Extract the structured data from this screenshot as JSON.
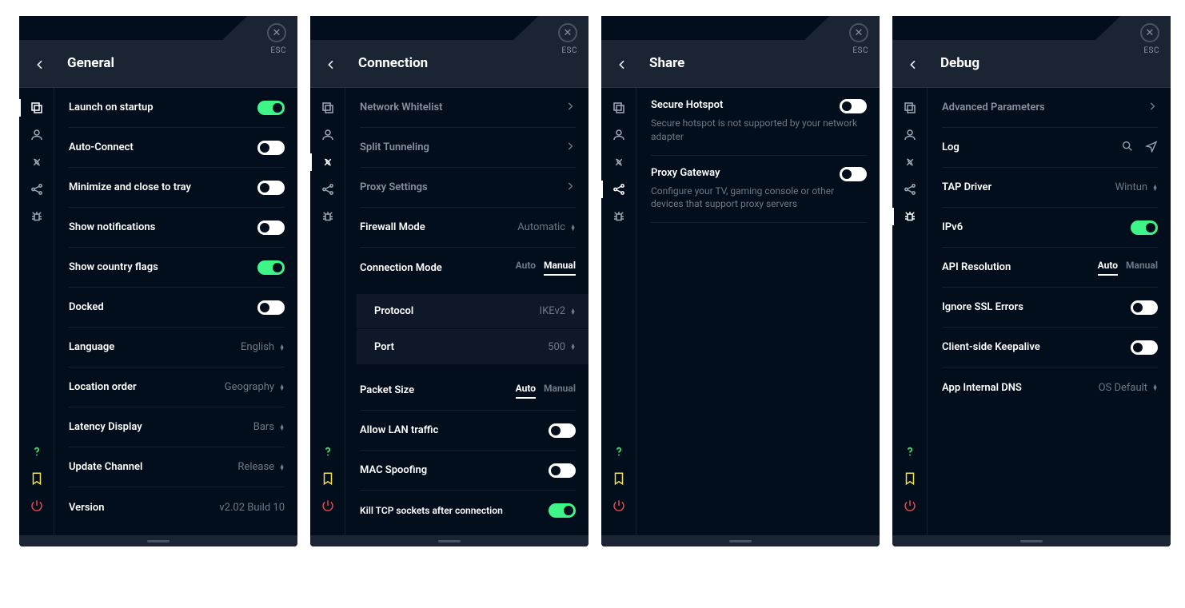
{
  "common": {
    "esc_label": "ESC"
  },
  "panels": {
    "general": {
      "title": "General",
      "items": {
        "launch_on_startup": "Launch on startup",
        "auto_connect": "Auto-Connect",
        "minimize_close_tray": "Minimize and close to tray",
        "show_notifications": "Show notifications",
        "show_country_flags": "Show country flags",
        "docked": "Docked",
        "language": "Language",
        "language_value": "English",
        "location_order": "Location order",
        "location_order_value": "Geography",
        "latency_display": "Latency Display",
        "latency_display_value": "Bars",
        "update_channel": "Update Channel",
        "update_channel_value": "Release",
        "version": "Version",
        "version_value": "v2.02 Build 10"
      }
    },
    "connection": {
      "title": "Connection",
      "items": {
        "network_whitelist": "Network Whitelist",
        "split_tunneling": "Split Tunneling",
        "proxy_settings": "Proxy Settings",
        "firewall_mode": "Firewall Mode",
        "firewall_mode_value": "Automatic",
        "connection_mode": "Connection Mode",
        "protocol": "Protocol",
        "protocol_value": "IKEv2",
        "port": "Port",
        "port_value": "500",
        "packet_size": "Packet Size",
        "allow_lan": "Allow LAN traffic",
        "mac_spoofing": "MAC Spoofing",
        "kill_tcp": "Kill TCP sockets after connection",
        "seg_auto": "Auto",
        "seg_manual": "Manual"
      }
    },
    "share": {
      "title": "Share",
      "items": {
        "secure_hotspot": "Secure Hotspot",
        "secure_hotspot_desc": "Secure hotspot is not supported by your network adapter",
        "proxy_gateway": "Proxy Gateway",
        "proxy_gateway_desc": "Configure your TV, gaming console or other devices that support proxy servers"
      }
    },
    "debug": {
      "title": "Debug",
      "items": {
        "advanced_params": "Advanced Parameters",
        "log": "Log",
        "tap_driver": "TAP Driver",
        "tap_driver_value": "Wintun",
        "ipv6": "IPv6",
        "api_resolution": "API Resolution",
        "seg_auto": "Auto",
        "seg_manual": "Manual",
        "ignore_ssl": "Ignore SSL Errors",
        "client_keepalive": "Client-side Keepalive",
        "app_internal_dns": "App Internal DNS",
        "app_internal_dns_value": "OS Default"
      }
    }
  }
}
